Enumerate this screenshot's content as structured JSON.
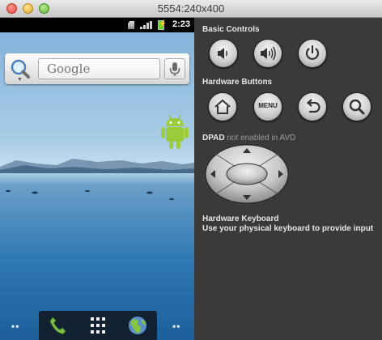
{
  "window": {
    "title": "5554:240x400"
  },
  "statusbar": {
    "time": "2:23"
  },
  "search": {
    "placeholder": "Google"
  },
  "panel": {
    "basic_controls": {
      "title": "Basic Controls",
      "buttons": [
        {
          "icon": "volume-down-icon"
        },
        {
          "icon": "volume-up-icon"
        },
        {
          "icon": "power-icon"
        }
      ]
    },
    "hardware_buttons": {
      "title": "Hardware Buttons",
      "buttons": [
        {
          "icon": "home-icon"
        },
        {
          "label": "MENU"
        },
        {
          "icon": "back-icon"
        },
        {
          "icon": "search-icon"
        }
      ]
    },
    "dpad": {
      "title": "DPAD",
      "note": "not enabled in AVD"
    },
    "keyboard": {
      "title": "Hardware Keyboard",
      "subtitle": "Use your physical keyboard to provide input"
    }
  },
  "colors": {
    "panel_bg": "#3a3a3a",
    "text": "#e6e6e6",
    "button_face": "#cfcfcf"
  }
}
